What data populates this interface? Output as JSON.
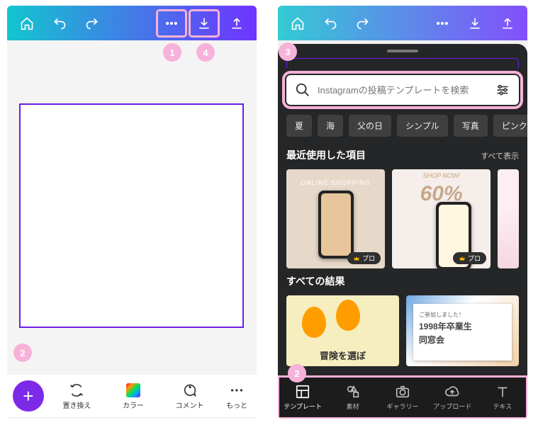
{
  "callouts": [
    "1",
    "2",
    "3",
    "4"
  ],
  "topbar_icons_semantics": [
    "home",
    "undo",
    "redo",
    "more",
    "download",
    "share"
  ],
  "left": {
    "bottom_items": [
      {
        "label": "置き換え",
        "icon": "swap"
      },
      {
        "label": "カラー",
        "icon": "color"
      },
      {
        "label": "コメント",
        "icon": "comment"
      },
      {
        "label": "もっと",
        "icon": "more"
      }
    ]
  },
  "right": {
    "search_placeholder": "Instagramの投稿テンプレートを検索",
    "chips": [
      "夏",
      "海",
      "父の日",
      "シンプル",
      "写真",
      "ピンク"
    ],
    "section_recent": {
      "title": "最近使用した項目",
      "see_all": "すべて表示"
    },
    "section_results": {
      "title": "すべての結果"
    },
    "thumbs": {
      "t1_text": "ONLINE SHOPPING",
      "t2_pre": "SHOP NOW!",
      "t2_text": "60%",
      "pro": "プロ"
    },
    "results": {
      "r1_caption": "冒険を選ぼ",
      "r2_line1": "ご参加しました！",
      "r2_line2": "1998年卒業生",
      "r2_line3": "同窓会"
    },
    "nav": [
      {
        "label": "テンプレート",
        "icon": "template"
      },
      {
        "label": "素材",
        "icon": "elements"
      },
      {
        "label": "ギャラリー",
        "icon": "gallery"
      },
      {
        "label": "アップロード",
        "icon": "upload"
      },
      {
        "label": "テキス",
        "icon": "text"
      }
    ]
  }
}
